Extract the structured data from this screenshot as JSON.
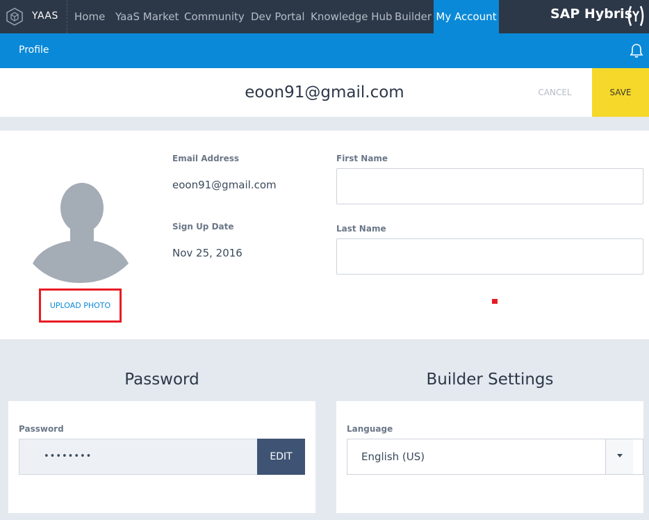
{
  "topnav": {
    "brand": "YAAS",
    "items": [
      "Home",
      "YaaS Market",
      "Community",
      "Dev Portal",
      "Knowledge Hub",
      "Builder",
      "My Account"
    ],
    "active_item": "My Account",
    "vendor_logo": "SAP Hybris"
  },
  "subbar": {
    "title": "Profile"
  },
  "header": {
    "email": "eoon91@gmail.com",
    "cancel_label": "CANCEL",
    "save_label": "SAVE"
  },
  "profile": {
    "upload_label": "UPLOAD PHOTO",
    "email_label": "Email Address",
    "email_value": "eoon91@gmail.com",
    "signup_label": "Sign Up Date",
    "signup_value": "Nov 25, 2016",
    "first_name_label": "First Name",
    "first_name_value": "",
    "last_name_label": "Last Name",
    "last_name_value": ""
  },
  "password_section": {
    "title": "Password",
    "field_label": "Password",
    "masked_value": "••••••••",
    "edit_label": "EDIT"
  },
  "builder_section": {
    "title": "Builder Settings",
    "language_label": "Language",
    "language_value": "English (US)"
  },
  "colors": {
    "nav_bg": "#2c3748",
    "accent_blue": "#0a89d8",
    "save_yellow": "#f6d82a",
    "highlight_red": "#e81b23",
    "edit_button": "#3f5474",
    "page_bg": "#e4e9ef"
  },
  "icons": [
    "yaas-cube-icon",
    "sap-hybris-mark-icon",
    "bell-icon",
    "avatar-placeholder-icon",
    "caret-down-icon"
  ]
}
